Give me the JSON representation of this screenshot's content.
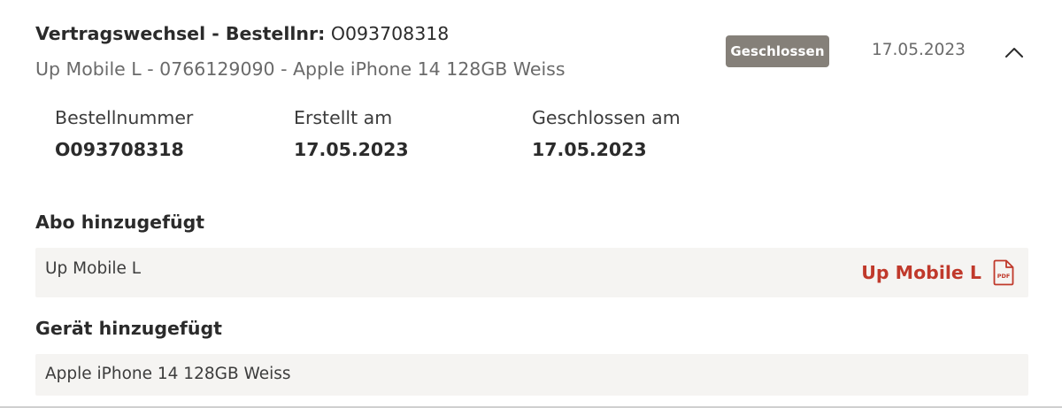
{
  "order": {
    "title_label": "Vertragswechsel - Bestellnr:",
    "title_number": "O093708318",
    "subtitle": "Up Mobile L - 0766129090 - Apple iPhone 14 128GB Weiss",
    "status": "Geschlossen",
    "date": "17.05.2023",
    "toggle_icon": "chevron-up-icon"
  },
  "details": {
    "order_number": {
      "label": "Bestellnummer",
      "value": "O093708318"
    },
    "created": {
      "label": "Erstellt am",
      "value": "17.05.2023"
    },
    "closed": {
      "label": "Geschlossen am",
      "value": "17.05.2023"
    }
  },
  "subscription": {
    "heading": "Abo hinzugefügt",
    "item": "Up Mobile L",
    "document_link": "Up Mobile L",
    "document_icon": "pdf-file-icon",
    "document_icon_text": "PDF"
  },
  "device": {
    "heading": "Gerät hinzugefügt",
    "item": "Apple iPhone 14 128GB Weiss"
  },
  "colors": {
    "status_badge": "#858079",
    "link": "#c0392b",
    "row_background": "#f5f4f2"
  }
}
